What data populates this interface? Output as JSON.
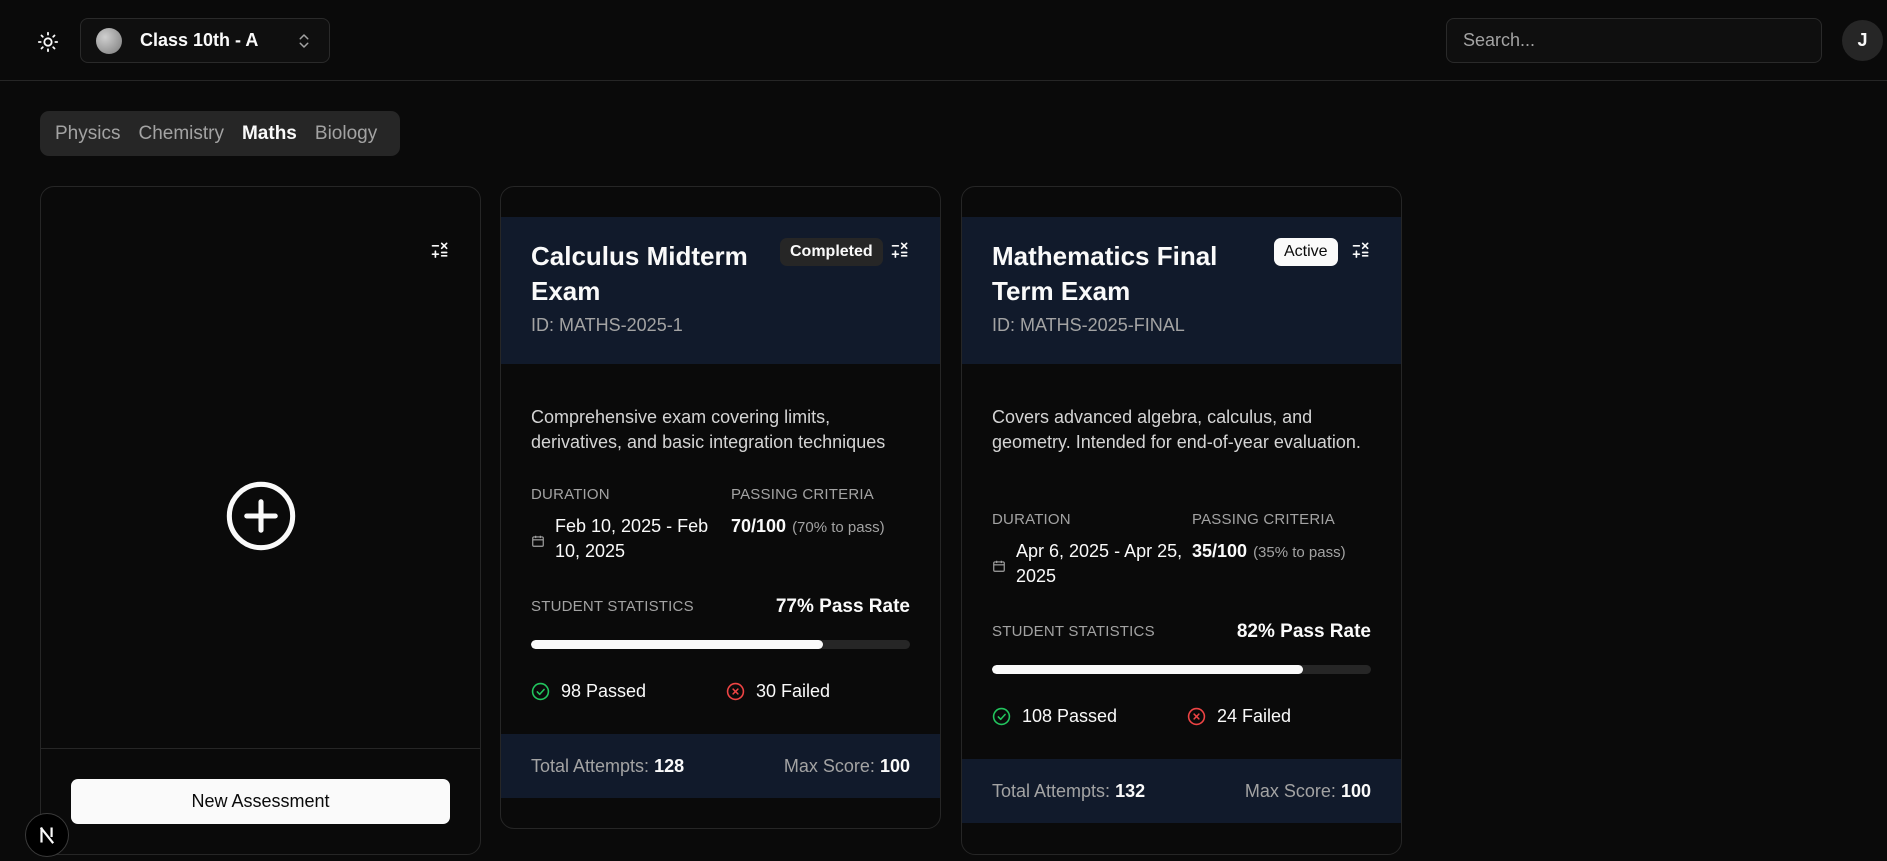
{
  "header": {
    "class_name": "Class 10th - A",
    "search_placeholder": "Search...",
    "user_initial": "J"
  },
  "tabs": [
    {
      "label": "Physics",
      "active": false
    },
    {
      "label": "Chemistry",
      "active": false
    },
    {
      "label": "Maths",
      "active": true
    },
    {
      "label": "Biology",
      "active": false
    }
  ],
  "new_assessment": {
    "button_label": "New Assessment"
  },
  "labels": {
    "duration": "DURATION",
    "passing_criteria": "PASSING CRITERIA",
    "student_statistics": "STUDENT STATISTICS",
    "total_attempts": "Total Attempts:",
    "max_score": "Max Score:"
  },
  "exams": [
    {
      "title": "Calculus Midterm Exam",
      "id": "ID: MATHS-2025-1",
      "status": "Completed",
      "description": "Comprehensive exam covering limits, derivatives, and basic integration techniques",
      "duration": "Feb 10, 2025 - Feb 10, 2025",
      "passing_score": "70/100",
      "passing_note": "(70% to pass)",
      "pass_rate": "77% Pass Rate",
      "pass_fraction": 0.77,
      "passed": "98 Passed",
      "failed": "30 Failed",
      "total_attempts": "128",
      "max_score": "100"
    },
    {
      "title": "Mathematics Final Term Exam",
      "id": "ID: MATHS-2025-FINAL",
      "status": "Active",
      "description": "Covers advanced algebra, calculus, and geometry. Intended for end-of-year evaluation.",
      "duration": "Apr 6, 2025 - Apr 25, 2025",
      "passing_score": "35/100",
      "passing_note": "(35% to pass)",
      "pass_rate": "82% Pass Rate",
      "pass_fraction": 0.82,
      "passed": "108 Passed",
      "failed": "24 Failed",
      "total_attempts": "132",
      "max_score": "100"
    }
  ],
  "colors": {
    "background": "#0a0a0a",
    "card_header": "#111a2b",
    "passed_icon": "#22c55e",
    "failed_icon": "#ef4444"
  },
  "icons": [
    "sun-icon",
    "chevrons-up-down-icon",
    "calculator-icon",
    "plus-circle-icon",
    "calendar-icon",
    "check-circle-icon",
    "x-circle-icon",
    "nextjs-logo-icon"
  ]
}
